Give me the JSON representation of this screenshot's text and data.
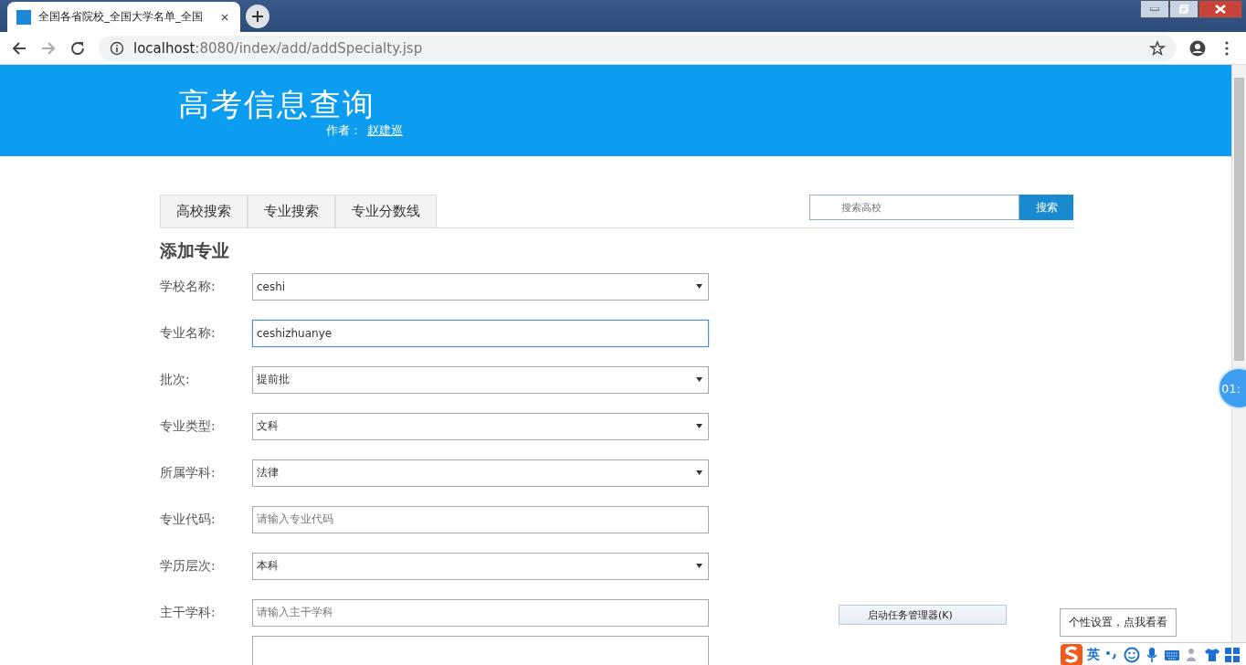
{
  "browser": {
    "tab_title": "全国各省院校_全国大学名单_全国",
    "url_host": "localhost",
    "url_rest": ":8080/index/add/addSpecialty.jsp"
  },
  "header": {
    "title": "高考信息查询",
    "author_label": "作者：",
    "author_name": "赵建巡"
  },
  "nav_tabs": [
    {
      "label": "高校搜索"
    },
    {
      "label": "专业搜索"
    },
    {
      "label": "专业分数线"
    }
  ],
  "search": {
    "placeholder": "搜索高校",
    "button": "搜索"
  },
  "form": {
    "title": "添加专业",
    "fields": [
      {
        "label": "学校名称:",
        "kind": "select",
        "value": "ceshi",
        "focused": false
      },
      {
        "label": "专业名称:",
        "kind": "input",
        "value": "ceshizhuanye",
        "focused": true
      },
      {
        "label": "批次:",
        "kind": "select",
        "value": "提前批",
        "focused": false
      },
      {
        "label": "专业类型:",
        "kind": "select",
        "value": "文科",
        "focused": false
      },
      {
        "label": "所属学科:",
        "kind": "select",
        "value": "法律",
        "focused": false
      },
      {
        "label": "专业代码:",
        "kind": "input",
        "placeholder": "请输入专业代码",
        "focused": false
      },
      {
        "label": "学历层次:",
        "kind": "select",
        "value": "本科",
        "focused": false
      },
      {
        "label": "主干学科:",
        "kind": "input",
        "placeholder": "请输入主干学科",
        "focused": false
      },
      {
        "kind": "textarea",
        "focused": false
      }
    ]
  },
  "context_menu": {
    "item": "启动任务管理器(K)"
  },
  "timer_badge": {
    "text": "01:"
  },
  "ime": {
    "tooltip": "个性设置，点我看看",
    "mode": "英"
  }
}
